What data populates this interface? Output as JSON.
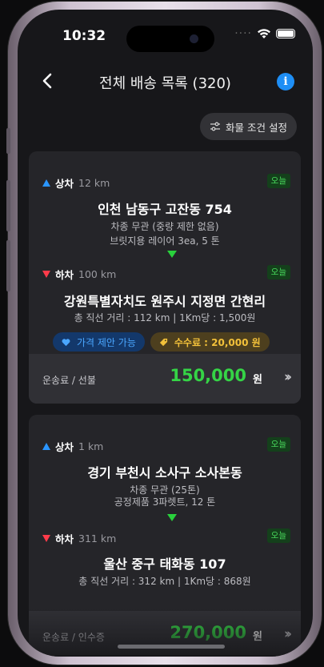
{
  "status_bar": {
    "time": "10:32"
  },
  "nav": {
    "title": "전체 배송 목록 (320)"
  },
  "filter": {
    "label": "화물 조건 설정"
  },
  "colors": {
    "accent_blue": "#1e8ef5",
    "price_green": "#35d446",
    "pickup": "#2a95ff",
    "dropoff": "#ff3b4a"
  },
  "cards": [
    {
      "pickup": {
        "kind": "상차",
        "distance": "12 km",
        "today": "오늘",
        "address": "인천 남동구 고잔동 754",
        "line1": "차종 무관 (중량 제한 없음)",
        "line2": "브릿지용 레이어 3ea, 5 톤"
      },
      "dropoff": {
        "kind": "하차",
        "distance": "100 km",
        "today": "오늘",
        "address": "강원특별자치도 원주시 지정면 간현리",
        "line1": "총 직선 거리 : 112 km | 1Km당 : 1,500원"
      },
      "badges": {
        "price_offer": "가격 제안 가능",
        "fee": "수수료 : 20,000 원"
      },
      "footer": {
        "label": "운송료 / 선불",
        "price": "150,000",
        "unit": "원"
      }
    },
    {
      "pickup": {
        "kind": "상차",
        "distance": "1 km",
        "today": "오늘",
        "address": "경기 부천시 소사구 소사본동",
        "line1": "차종 무관 (25톤)",
        "line2": "공정제품 3파렛트, 12 톤"
      },
      "dropoff": {
        "kind": "하차",
        "distance": "311 km",
        "today": "오늘",
        "address": "울산 중구 태화동 107",
        "line1": "총 직선 거리 : 312 km | 1Km당 : 868원"
      },
      "footer": {
        "label": "운송료 / 인수증",
        "price": "270,000",
        "unit": "원"
      }
    }
  ]
}
